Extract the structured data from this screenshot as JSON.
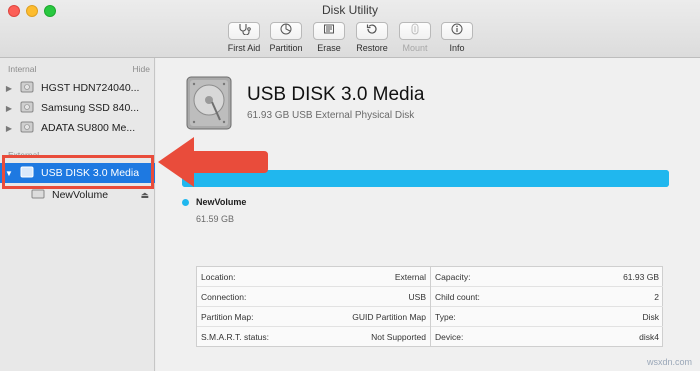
{
  "window": {
    "title": "Disk Utility"
  },
  "toolbar": {
    "items": [
      {
        "label": "First Aid",
        "icon": "stethoscope-icon",
        "enabled": true
      },
      {
        "label": "Partition",
        "icon": "partition-icon",
        "enabled": true
      },
      {
        "label": "Erase",
        "icon": "erase-icon",
        "enabled": true
      },
      {
        "label": "Restore",
        "icon": "restore-icon",
        "enabled": true
      },
      {
        "label": "Mount",
        "icon": "mount-icon",
        "enabled": false
      },
      {
        "label": "Info",
        "icon": "info-icon",
        "enabled": true
      }
    ]
  },
  "sidebar": {
    "internal_header": "Internal",
    "hide_label": "Hide",
    "internal_items": [
      {
        "label": "HGST HDN724040..."
      },
      {
        "label": "Samsung SSD 840..."
      },
      {
        "label": "ADATA SU800 Me..."
      }
    ],
    "external_header": "External",
    "external_items": [
      {
        "label": "USB DISK 3.0 Media",
        "selected": true
      },
      {
        "label": "NewVolume",
        "eject": "⏏"
      }
    ]
  },
  "main": {
    "disk_name": "USB DISK 3.0 Media",
    "disk_desc": "61.93 GB USB External Physical Disk",
    "usage_fraction": 1.0,
    "volume": {
      "name": "NewVolume",
      "size": "61.59 GB"
    },
    "info_left": [
      {
        "key": "Location:",
        "value": "External"
      },
      {
        "key": "Connection:",
        "value": "USB"
      },
      {
        "key": "Partition Map:",
        "value": "GUID Partition Map"
      },
      {
        "key": "S.M.A.R.T. status:",
        "value": "Not Supported"
      }
    ],
    "info_right": [
      {
        "key": "Capacity:",
        "value": "61.93 GB"
      },
      {
        "key": "Child count:",
        "value": "2"
      },
      {
        "key": "Type:",
        "value": "Disk"
      },
      {
        "key": "Device:",
        "value": "disk4"
      }
    ]
  },
  "colors": {
    "accent": "#1e79e1",
    "usage": "#20b7ee",
    "annotation": "#e94c3b"
  },
  "watermark": "wsxdn.com"
}
